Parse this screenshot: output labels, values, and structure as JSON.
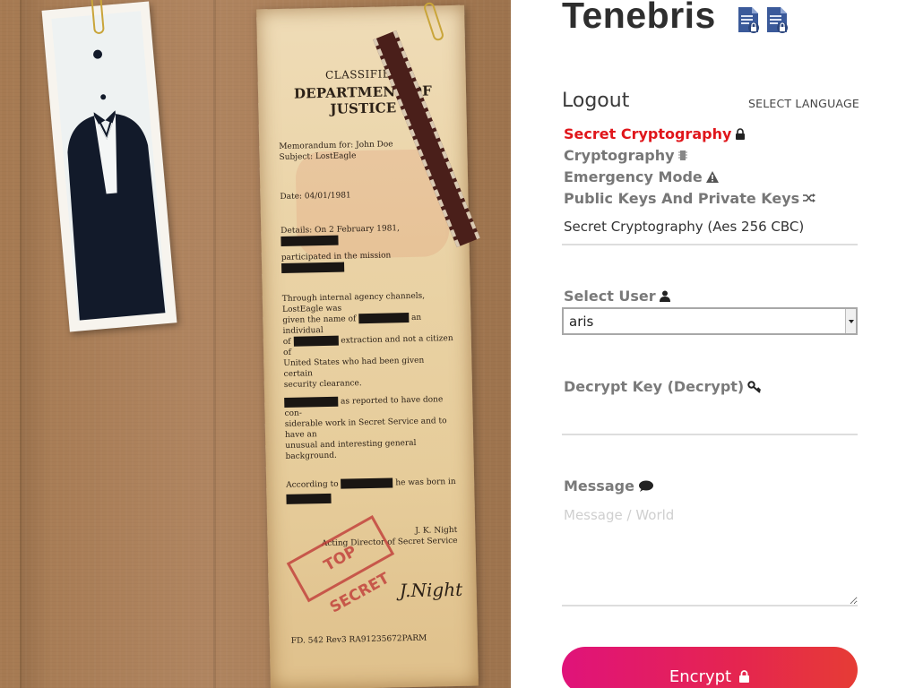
{
  "app": {
    "title": "Tenebris"
  },
  "header": {
    "logout_label": "Logout",
    "language_label": "SELECT LANGUAGE"
  },
  "menu": {
    "items": [
      {
        "label": "Secret Cryptography",
        "icon": "lock-icon",
        "active": true
      },
      {
        "label": "Cryptography",
        "icon": "chip-icon",
        "active": false
      },
      {
        "label": "Emergency Mode",
        "icon": "warning-icon",
        "active": false
      },
      {
        "label": "Public Keys And Private Keys",
        "icon": "shuffle-icon",
        "active": false
      }
    ]
  },
  "mode": {
    "selected": "Secret Cryptography (Aes 256 CBC)"
  },
  "user_field": {
    "label": "Select User",
    "icon": "user-icon",
    "selected": "aris"
  },
  "key_field": {
    "label": "Decrypt Key (Decrypt)",
    "icon": "key-icon",
    "value": ""
  },
  "message_field": {
    "label": "Message",
    "icon": "comment-icon",
    "placeholder": "Message / World",
    "value": ""
  },
  "encrypt_button": {
    "label": "Encrypt",
    "icon": "lock-icon"
  },
  "colors": {
    "active": "#e0161b",
    "muted": "#777777",
    "button_start": "#e0137a",
    "button_end": "#e63c35"
  },
  "document": {
    "header1": "CLASSIFIED",
    "header2": "DEPARTMENT OF JUSTICE",
    "memo_line1": "Memorandum for: John Doe",
    "memo_line2": "Subject: LostEagle",
    "date": "Date: 04/01/1981",
    "details1": "Details: On 2 February 1981,",
    "details2": "participated in the mission",
    "para1_1": "Through internal agency channels, LostEagle was",
    "para1_2": "given the name of",
    "para1_3": "an individual",
    "para1_4": "of",
    "para1_5": "extraction and not a citizen of",
    "para1_6": "United States who had been given certain",
    "para1_7": "security clearance.",
    "para2_1": "as reported to have done con-",
    "para2_2": "siderable work in Secret Service and to have an",
    "para2_3": "unusual and interesting general background.",
    "para3_1": "According to",
    "para3_2": "he was born in",
    "sign_name": "J. K. Night",
    "sign_title": "Acting Director of Secret Service",
    "stamp": "TOP SECRET",
    "footer": "FD. 542 Rev3 RA91235672PARM"
  }
}
